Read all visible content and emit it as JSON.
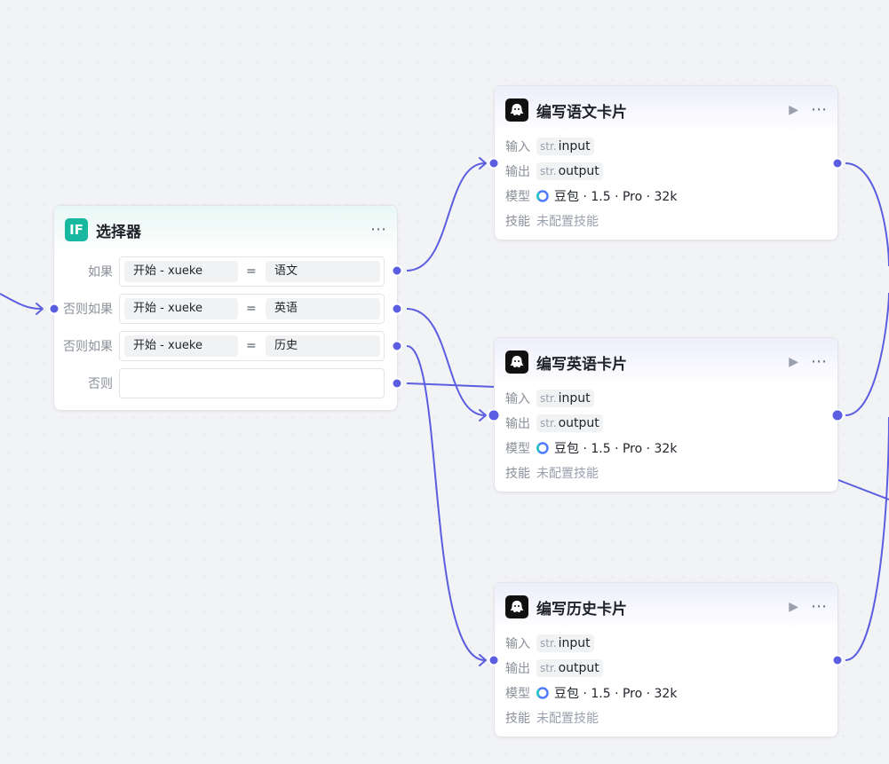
{
  "selector": {
    "title": "选择器",
    "icon": "if-icon",
    "icon_text": "IF",
    "menu_icon": "more-icon",
    "branches": [
      {
        "label": "如果",
        "left": "开始 - xueke",
        "op": "=",
        "right": "语文"
      },
      {
        "label": "否则如果",
        "left": "开始 - xueke",
        "op": "=",
        "right": "英语"
      },
      {
        "label": "否则如果",
        "left": "开始 - xueke",
        "op": "=",
        "right": "历史"
      },
      {
        "label": "否则",
        "left": "",
        "op": "",
        "right": ""
      }
    ]
  },
  "llm_nodes": [
    {
      "title": "编写语文卡片",
      "input_label": "输入",
      "input_type": "str.",
      "input_name": "input",
      "output_label": "输出",
      "output_type": "str.",
      "output_name": "output",
      "model_label": "模型",
      "model_value": "豆包 · 1.5 · Pro · 32k",
      "skill_label": "技能",
      "skill_value": "未配置技能"
    },
    {
      "title": "编写英语卡片",
      "input_label": "输入",
      "input_type": "str.",
      "input_name": "input",
      "output_label": "输出",
      "output_type": "str.",
      "output_name": "output",
      "model_label": "模型",
      "model_value": "豆包 · 1.5 · Pro · 32k",
      "skill_label": "技能",
      "skill_value": "未配置技能"
    },
    {
      "title": "编写历史卡片",
      "input_label": "输入",
      "input_type": "str.",
      "input_name": "input",
      "output_label": "输出",
      "output_type": "str.",
      "output_name": "output",
      "model_label": "模型",
      "model_value": "豆包 · 1.5 · Pro · 32k",
      "skill_label": "技能",
      "skill_value": "未配置技能"
    }
  ],
  "icons": {
    "llm_node": "robot-icon",
    "run": "play-icon",
    "menu": "more-icon",
    "model": "doubao-model-icon"
  },
  "colors": {
    "edge": "#5b5ee0",
    "selector_icon": "#18b7a0",
    "llm_icon": "#111111"
  }
}
